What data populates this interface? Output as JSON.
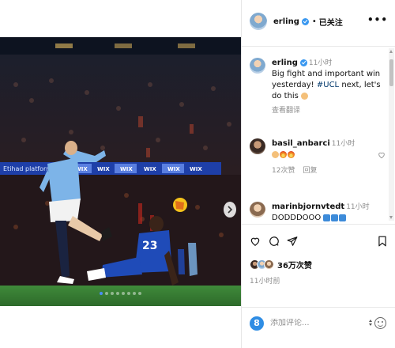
{
  "post": {
    "username": "erling",
    "follow_separator": "•",
    "follow_state": "已关注",
    "more_label": "•••",
    "caption_username": "erling",
    "caption_time": "11小时",
    "caption_before_tag": "Big fight and important win yesterday! ",
    "caption_hashtag": "#UCL",
    "caption_after_tag": " next, let's do this",
    "translate_label": "查看翻译",
    "likes": "36万次赞",
    "posted": "11小时前",
    "carousel_count": 8,
    "carousel_active": 0
  },
  "photo": {
    "stadium_banner": "Etihad platform",
    "banner_repeat": "WIX",
    "player_number": "23"
  },
  "comments": [
    {
      "username": "basil_anbarci",
      "time": "11小时",
      "replies": "12次赞",
      "reply_label": "回复"
    },
    {
      "username": "marinbjornvtedt",
      "time": "11小时",
      "text": "DODDDOOO"
    }
  ],
  "composer": {
    "placeholder": "添加评论...",
    "sticker_label": "8"
  },
  "icons": [
    "heart-icon",
    "comment-icon",
    "share-icon",
    "bookmark-icon",
    "chevron-right-icon",
    "emoji-icon"
  ],
  "colors": {
    "link": "#00376b",
    "verified": "#3897f0",
    "muted": "#8e8e8e",
    "active_dot": "#4a8df6"
  }
}
